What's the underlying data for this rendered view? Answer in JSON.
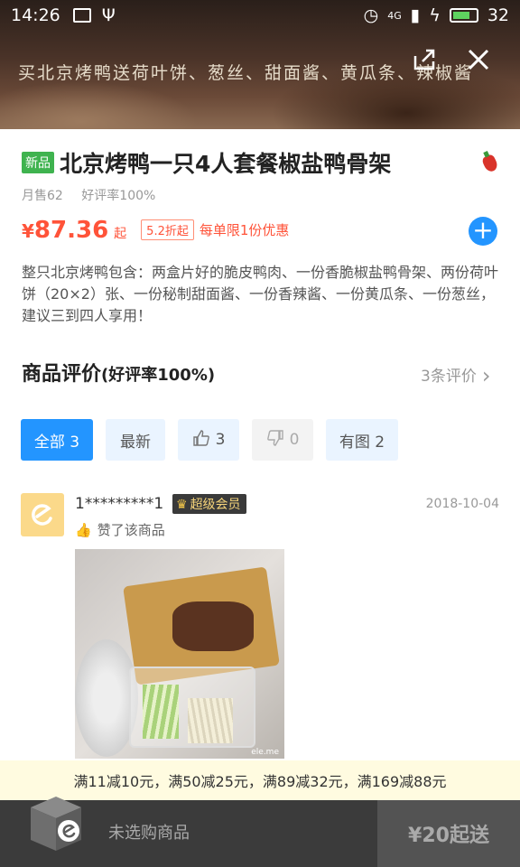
{
  "status": {
    "time": "14:26",
    "network": "4G",
    "battery": "32"
  },
  "banner": {
    "text": "买北京烤鸭送荷叶饼、葱丝、甜面酱、黄瓜条、辣椒酱"
  },
  "product": {
    "badge": "新品",
    "title": "北京烤鸭一只4人套餐椒盐鸭骨架",
    "sales": "月售62",
    "rating": "好评率100%",
    "price_symbol": "¥",
    "price": "87.36",
    "price_unit": "起",
    "discount": "5.2折起",
    "limit": "每单限1份优惠",
    "description": "整只北京烤鸭包含：两盒片好的脆皮鸭肉、一份香脆椒盐鸭骨架、两份荷叶饼（20×2）张、一份秘制甜面酱、一份香辣酱、一份黄瓜条、一份葱丝，建议三到四人享用！"
  },
  "reviews": {
    "title": "商品评价",
    "rate": "(好评率100%)",
    "count": "3条评价",
    "tabs": {
      "all": "全部 3",
      "latest": "最新",
      "good": "3",
      "bad": "0",
      "with_photo": "有图 2"
    },
    "items": [
      {
        "user": "1*********1",
        "vip": "超级会员",
        "date": "2018-10-04",
        "liked": "赞了该商品",
        "photo_watermark": "ele.me"
      }
    ]
  },
  "promo": {
    "text": "满11减10元，满50减25元，满89减32元，满169减88元"
  },
  "cart": {
    "empty": "未选购商品",
    "checkout": "¥20起送"
  },
  "colors": {
    "accent": "#2395ff",
    "price": "#ff5339",
    "new_badge": "#3fb34f"
  }
}
